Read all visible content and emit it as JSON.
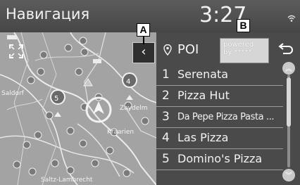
{
  "header": {
    "title": "Навигация",
    "clock": "3:27",
    "wifi_icon": "wifi-icon"
  },
  "map": {
    "labels": [
      "Zaydelm",
      "Kraarien",
      "Saldorf",
      "Saltz-Lambrecht"
    ],
    "buttons": {
      "fullscreen_icon": "expand-icon",
      "collapse_icon": "chevron-left-icon",
      "collapse_glyph": "‹"
    }
  },
  "panel": {
    "poi_label": "POI",
    "powered_by": {
      "line1": "powered",
      "line2": "by *****"
    },
    "back_icon": "back-arrow-icon",
    "results": [
      {
        "num": "1",
        "name": "Serenata"
      },
      {
        "num": "2",
        "name": "Pizza Hut"
      },
      {
        "num": "3",
        "name": "Da Pepe Pizza Pasta ..."
      },
      {
        "num": "4",
        "name": "Las Pizza"
      },
      {
        "num": "5",
        "name": "Domino's Pizza"
      }
    ],
    "scroll": {
      "up_glyph": "︽",
      "down_glyph": "︾"
    }
  },
  "callouts": {
    "a": "A",
    "b": "B"
  },
  "colors": {
    "background": "#4a4a4a",
    "map": "#a7a7a7",
    "text": "#f2f2f2"
  }
}
